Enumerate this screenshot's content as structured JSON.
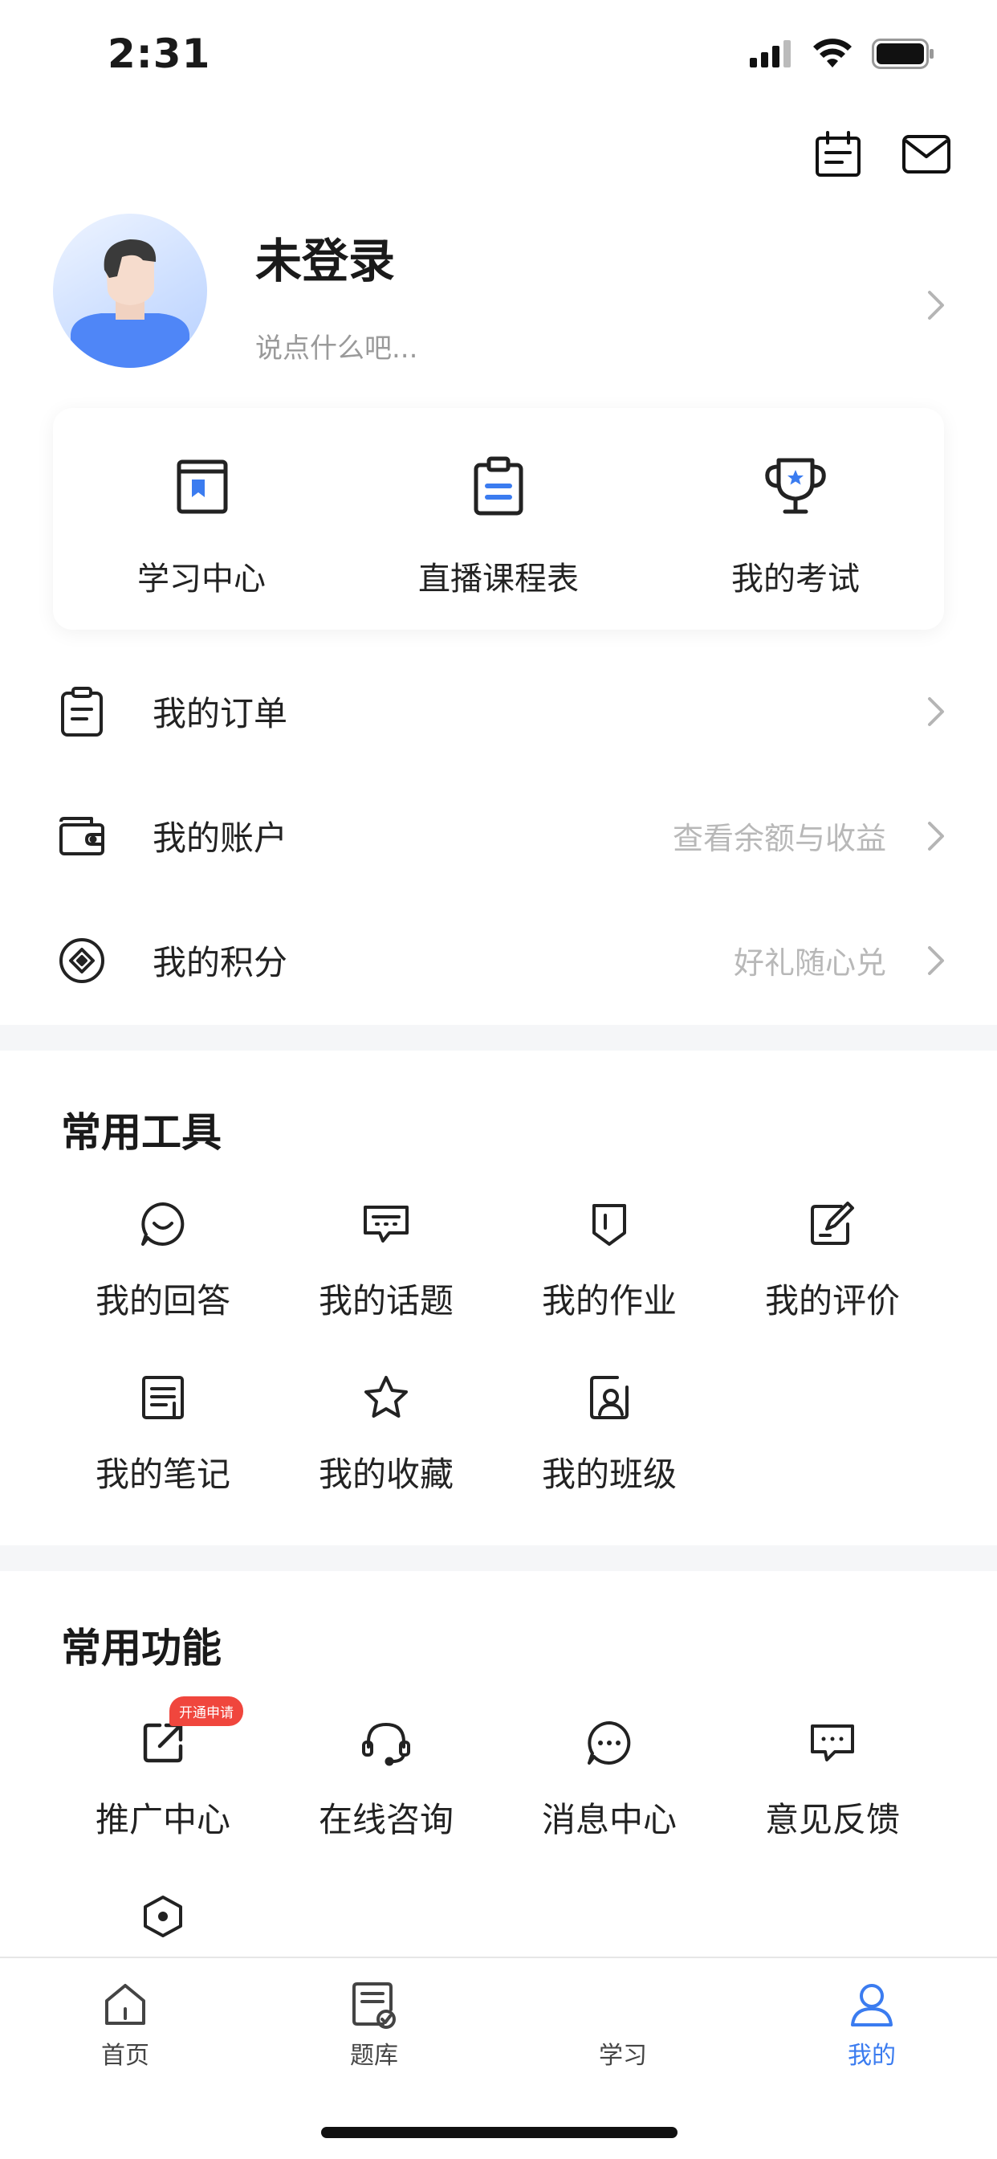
{
  "status": {
    "time": "2:31"
  },
  "profile": {
    "name": "未登录",
    "signature": "说点什么吧..."
  },
  "quick_actions": [
    {
      "label": "学习中心",
      "icon": "book-bookmark-icon"
    },
    {
      "label": "直播课程表",
      "icon": "clipboard-list-icon"
    },
    {
      "label": "我的考试",
      "icon": "trophy-icon"
    }
  ],
  "menu": [
    {
      "label": "我的订单",
      "hint": "",
      "icon": "order-icon"
    },
    {
      "label": "我的账户",
      "hint": "查看余额与收益",
      "icon": "wallet-icon"
    },
    {
      "label": "我的积分",
      "hint": "好礼随心兑",
      "icon": "points-icon"
    }
  ],
  "tools": {
    "title": "常用工具",
    "items": [
      {
        "label": "我的回答",
        "icon": "answer-icon"
      },
      {
        "label": "我的话题",
        "icon": "topic-icon"
      },
      {
        "label": "我的作业",
        "icon": "homework-icon"
      },
      {
        "label": "我的评价",
        "icon": "review-icon"
      },
      {
        "label": "我的笔记",
        "icon": "notes-icon"
      },
      {
        "label": "我的收藏",
        "icon": "star-icon"
      },
      {
        "label": "我的班级",
        "icon": "class-icon"
      }
    ]
  },
  "functions": {
    "title": "常用功能",
    "items": [
      {
        "label": "推广中心",
        "icon": "share-icon",
        "badge": "开通申请"
      },
      {
        "label": "在线咨询",
        "icon": "headset-icon"
      },
      {
        "label": "消息中心",
        "icon": "message-icon"
      },
      {
        "label": "意见反馈",
        "icon": "feedback-icon"
      },
      {
        "label": "",
        "icon": "settings-hexagon-icon"
      }
    ]
  },
  "tabbar": [
    {
      "label": "首页",
      "icon": "home-icon",
      "active": false
    },
    {
      "label": "题库",
      "icon": "question-bank-icon",
      "active": false
    },
    {
      "label": "学习",
      "icon": "",
      "active": false
    },
    {
      "label": "我的",
      "icon": "user-icon",
      "active": true
    }
  ],
  "colors": {
    "accent": "#3b7cf0",
    "badge": "#f0463d",
    "divider": "#f5f6f8"
  }
}
